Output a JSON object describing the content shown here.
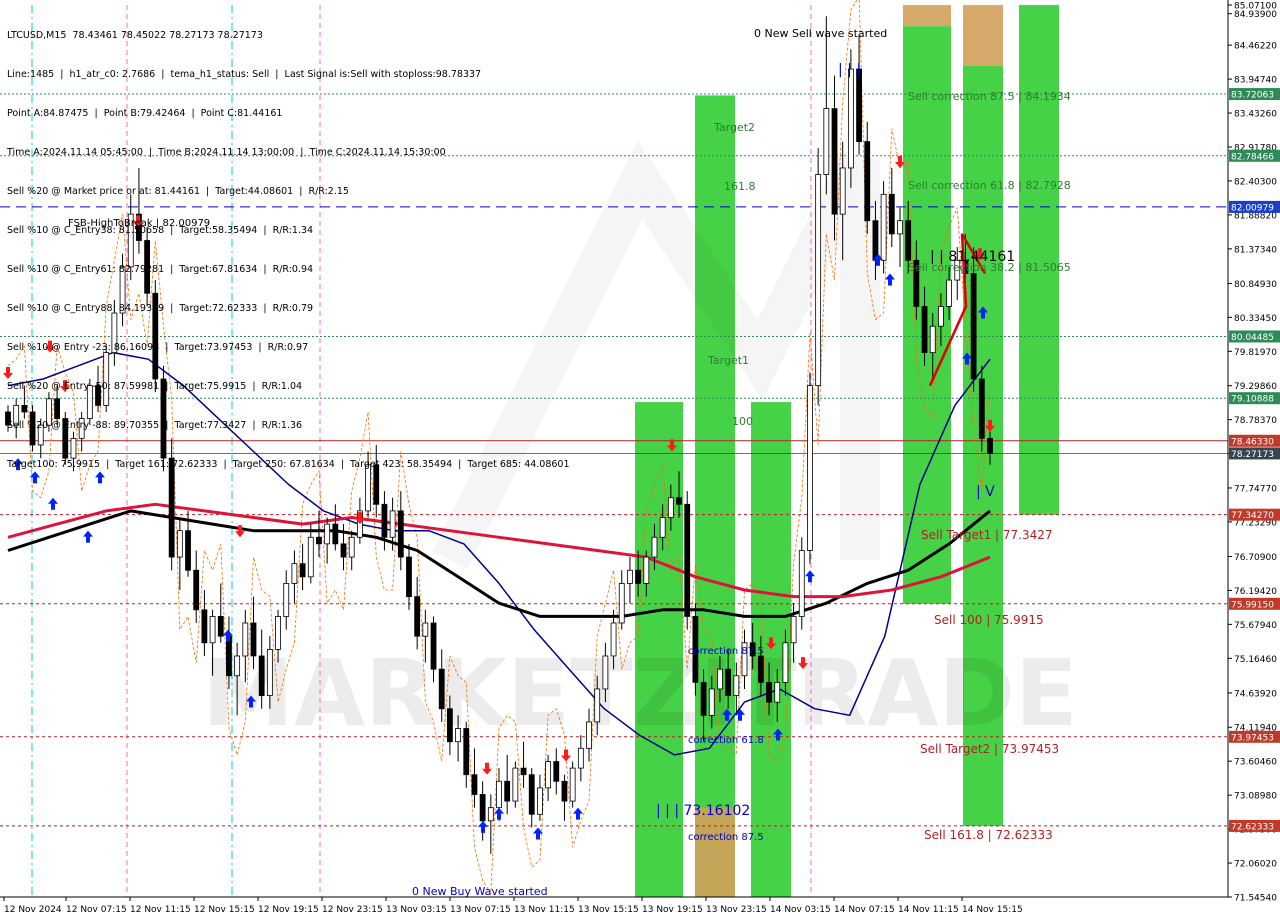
{
  "symbol_header": "LTCUSD,M15  78.43461 78.45022 78.27173 78.27173",
  "info_lines": [
    "Line:1485  |  h1_atr_c0: 2.7686  |  tema_h1_status: Sell  |  Last Signal is:Sell with stoploss:98.78337",
    "Point A:84.87475  |  Point B:79.42464  |  Point C:81.44161",
    "Time A:2024.11.14 05:45:00  |  Time B:2024.11.14 13:00:00  |  Time C:2024.11.14 15:30:00",
    "Sell %20 @ Market price or at: 81.44161  |  Target:44.08601  |  R/R:2.15",
    "Sell %10 @ C_Entry38: 81.50658  |  Target:58.35494  |  R/R:1.34",
    "Sell %10 @ C_Entry61: 82.79281  |  Target:67.81634  |  R/R:0.94",
    "Sell %10 @ C_Entry88: 84.19349  |  Target:72.62333  |  R/R:0.79",
    "Sell %10 @ Entry -23: 86.16098  |  Target:73.97453  |  R/R:0.97",
    "Sell %20 @ Entry -50: 87.59981  |  Target:75.9915  |  R/R:1.04",
    "Sell %20 @ Entry -88: 89.70355  |  Target:77.3427  |  R/R:1.36",
    "Target100: 75.9915  |  Target 161: 72.62333  |  Target 250: 67.81634  |  Target 423: 58.35494  |  Target 685: 44.08601"
  ],
  "watermark": "MARKETZITRADE",
  "colors": {
    "bull_candle": "#000000",
    "bear_candle": "#000000",
    "ema_blue": "#00008b",
    "ema_black": "#000000",
    "ema_red": "#dc143c",
    "green_zone": "#32cd32",
    "orange_zone": "#d2a05a",
    "level_green": "#2e8b57",
    "level_red": "#b22222",
    "level_blue": "#0000cd",
    "price_current": "#36454f"
  },
  "chart_data": {
    "type": "candlestick",
    "title": "LTCUSD,M15",
    "ylim": [
      71.5454,
      85.071
    ],
    "y_ticks": [
      "85.07100",
      "84.93900",
      "84.46220",
      "83.94740",
      "83.43260",
      "82.91780",
      "82.40300",
      "81.88820",
      "81.37340",
      "80.84930",
      "80.33450",
      "79.81970",
      "79.29860",
      "78.78370",
      "78.26890",
      "77.74770",
      "77.23290",
      "76.70900",
      "76.19420",
      "75.67940",
      "75.16460",
      "74.63920",
      "74.11940",
      "73.60460",
      "73.08980",
      "72.57500",
      "72.06020",
      "71.54540"
    ],
    "x_ticks": [
      "12 Nov 2024",
      "12 Nov 07:15",
      "12 Nov 11:15",
      "12 Nov 15:15",
      "12 Nov 19:15",
      "12 Nov 23:15",
      "13 Nov 03:15",
      "13 Nov 07:15",
      "13 Nov 11:15",
      "13 Nov 15:15",
      "13 Nov 19:15",
      "13 Nov 23:15",
      "14 Nov 03:15",
      "14 Nov 07:15",
      "14 Nov 11:15",
      "14 Nov 15:15"
    ],
    "price_tags": [
      {
        "value": "83.72063",
        "kind": "green"
      },
      {
        "value": "82.78466",
        "kind": "green"
      },
      {
        "value": "82.00979",
        "kind": "blue"
      },
      {
        "value": "80.04485",
        "kind": "green"
      },
      {
        "value": "79.10888",
        "kind": "green"
      },
      {
        "value": "78.46330",
        "kind": "red"
      },
      {
        "value": "78.27173",
        "kind": "current"
      },
      {
        "value": "77.34270",
        "kind": "red"
      },
      {
        "value": "75.99150",
        "kind": "red"
      },
      {
        "value": "73.97453",
        "kind": "red"
      },
      {
        "value": "72.62333",
        "kind": "red"
      }
    ],
    "levels": [
      {
        "price": 83.72063,
        "style": "green-dotted"
      },
      {
        "price": 82.78466,
        "style": "green-dotted"
      },
      {
        "price": 82.00979,
        "style": "blue-dashed"
      },
      {
        "price": 80.04485,
        "style": "green-dotted"
      },
      {
        "price": 79.10888,
        "style": "green-dotted"
      },
      {
        "price": 78.4633,
        "style": "red-solid"
      },
      {
        "price": 78.27173,
        "style": "current"
      },
      {
        "price": 77.3427,
        "style": "red-dashed"
      },
      {
        "price": 75.9915,
        "style": "red-dashed"
      },
      {
        "price": 73.97453,
        "style": "red-dashed"
      },
      {
        "price": 72.62333,
        "style": "red-dashed"
      }
    ],
    "annotations": {
      "fsb_label": "FSB-HighToBreak  |  82.00979",
      "new_sell_wave": "0 New Sell wave started",
      "new_buy_wave": "0 New Buy Wave started",
      "target2": "Target2",
      "target1": "Target1",
      "fib_1618": "161.8",
      "fib_100": "100",
      "correction_875_top": "correction 87.5",
      "correction_618": "correction 61.8",
      "correction_875_bottom": "correction 87.5",
      "point_low": "| | | 73.16102",
      "point_high": "| | |",
      "point_c": "| | 81.44161",
      "sell_corr_875": "Sell correction 87.5 | 84.1934",
      "sell_corr_618": "Sell correction 61.8 | 82.7928",
      "sell_corr_382": "Sell correction 38.2 | 81.5065",
      "sell_target1": "Sell Target1 | 77.3427",
      "sell_100": "Sell 100 | 75.9915",
      "sell_target2": "Sell Target2 | 73.97453",
      "sell_1618": "Sell 161.8 | 72.62333",
      "iv_mark": "| V"
    },
    "series": [
      {
        "name": "EMA blue",
        "values": [
          79.3,
          79.4,
          79.6,
          79.8,
          79.7,
          79.3,
          78.8,
          78.3,
          77.8,
          77.4,
          77.2,
          77.1,
          77.1,
          76.9,
          76.3,
          75.6,
          75.0,
          74.4,
          74.0,
          73.7,
          73.8,
          74.5,
          74.7,
          74.4,
          74.3,
          75.5,
          77.8,
          79.0,
          79.7
        ]
      },
      {
        "name": "EMA black",
        "values": [
          76.8,
          77.0,
          77.2,
          77.4,
          77.3,
          77.2,
          77.1,
          77.1,
          77.1,
          77.0,
          76.8,
          76.4,
          76.0,
          75.8,
          75.8,
          75.8,
          75.9,
          75.9,
          75.8,
          75.8,
          76.0,
          76.3,
          76.5,
          76.9,
          77.4
        ]
      },
      {
        "name": "EMA red",
        "values": [
          77.0,
          77.2,
          77.4,
          77.5,
          77.4,
          77.3,
          77.2,
          77.3,
          77.2,
          77.1,
          77.0,
          76.9,
          76.8,
          76.7,
          76.4,
          76.2,
          76.1,
          76.1,
          76.2,
          76.4,
          76.7
        ]
      }
    ],
    "candles": [
      [
        78.9,
        79.0,
        78.6,
        78.7
      ],
      [
        78.7,
        79.1,
        78.5,
        79.0
      ],
      [
        79.0,
        79.3,
        78.8,
        78.9
      ],
      [
        78.9,
        79.0,
        78.3,
        78.4
      ],
      [
        78.4,
        78.8,
        78.2,
        78.7
      ],
      [
        78.7,
        79.2,
        78.6,
        79.1
      ],
      [
        79.1,
        79.3,
        78.7,
        78.8
      ],
      [
        78.8,
        78.9,
        78.1,
        78.2
      ],
      [
        78.2,
        78.6,
        78.0,
        78.5
      ],
      [
        78.5,
        78.9,
        78.3,
        78.8
      ],
      [
        78.8,
        79.4,
        78.7,
        79.3
      ],
      [
        79.3,
        79.6,
        78.9,
        79.0
      ],
      [
        79.0,
        79.9,
        78.9,
        79.8
      ],
      [
        79.8,
        80.6,
        79.6,
        80.4
      ],
      [
        80.4,
        81.3,
        80.2,
        81.1
      ],
      [
        81.1,
        82.2,
        80.9,
        81.9
      ],
      [
        81.9,
        82.6,
        81.3,
        81.5
      ],
      [
        81.5,
        81.7,
        80.5,
        80.7
      ],
      [
        80.7,
        80.9,
        79.2,
        79.4
      ],
      [
        79.4,
        79.6,
        78.0,
        78.2
      ],
      [
        78.2,
        78.5,
        76.5,
        76.7
      ],
      [
        76.7,
        77.3,
        76.2,
        77.1
      ],
      [
        77.1,
        77.4,
        76.4,
        76.5
      ],
      [
        76.5,
        76.8,
        75.7,
        75.9
      ],
      [
        75.9,
        76.2,
        75.2,
        75.4
      ],
      [
        75.4,
        75.9,
        74.9,
        75.8
      ],
      [
        75.8,
        76.3,
        75.4,
        75.5
      ],
      [
        75.5,
        75.8,
        74.7,
        74.9
      ],
      [
        74.9,
        75.4,
        74.3,
        75.2
      ],
      [
        75.2,
        75.9,
        74.8,
        75.7
      ],
      [
        75.7,
        76.1,
        75.0,
        75.2
      ],
      [
        75.2,
        75.6,
        74.4,
        74.6
      ],
      [
        74.6,
        75.5,
        74.4,
        75.3
      ],
      [
        75.3,
        75.9,
        75.1,
        75.8
      ],
      [
        75.8,
        76.5,
        75.6,
        76.3
      ],
      [
        76.3,
        76.8,
        76.0,
        76.6
      ],
      [
        76.6,
        76.9,
        76.2,
        76.4
      ],
      [
        76.4,
        77.2,
        76.3,
        77.0
      ],
      [
        77.0,
        77.4,
        76.7,
        76.9
      ],
      [
        76.9,
        77.3,
        76.6,
        77.2
      ],
      [
        77.2,
        77.5,
        76.8,
        76.9
      ],
      [
        76.9,
        77.2,
        76.5,
        76.7
      ],
      [
        76.7,
        77.1,
        76.5,
        77.0
      ],
      [
        77.0,
        77.6,
        76.9,
        77.4
      ],
      [
        77.4,
        78.3,
        77.3,
        78.1
      ],
      [
        78.1,
        78.4,
        77.3,
        77.5
      ],
      [
        77.5,
        77.7,
        76.8,
        77.0
      ],
      [
        77.0,
        77.6,
        76.8,
        77.4
      ],
      [
        77.4,
        77.7,
        76.5,
        76.7
      ],
      [
        76.7,
        76.9,
        75.9,
        76.1
      ],
      [
        76.1,
        76.4,
        75.3,
        75.5
      ],
      [
        75.5,
        75.9,
        75.1,
        75.7
      ],
      [
        75.7,
        75.8,
        74.8,
        75.0
      ],
      [
        75.0,
        75.3,
        74.2,
        74.4
      ],
      [
        74.4,
        74.6,
        73.7,
        73.9
      ],
      [
        73.9,
        74.3,
        73.6,
        74.1
      ],
      [
        74.1,
        74.2,
        73.2,
        73.4
      ],
      [
        73.4,
        73.8,
        72.9,
        73.1
      ],
      [
        73.1,
        73.3,
        72.4,
        72.7
      ],
      [
        72.7,
        73.1,
        72.2,
        72.9
      ],
      [
        72.9,
        73.5,
        72.7,
        73.3
      ],
      [
        73.3,
        73.7,
        72.8,
        73.0
      ],
      [
        73.0,
        73.6,
        72.9,
        73.5
      ],
      [
        73.5,
        73.9,
        73.2,
        73.4
      ],
      [
        73.4,
        73.5,
        72.6,
        72.8
      ],
      [
        72.8,
        73.4,
        72.7,
        73.2
      ],
      [
        73.2,
        73.7,
        73.0,
        73.6
      ],
      [
        73.6,
        73.8,
        73.1,
        73.3
      ],
      [
        73.3,
        73.4,
        72.7,
        73.0
      ],
      [
        73.0,
        73.6,
        72.9,
        73.5
      ],
      [
        73.5,
        74.0,
        73.3,
        73.8
      ],
      [
        73.8,
        74.4,
        73.6,
        74.2
      ],
      [
        74.2,
        74.9,
        74.0,
        74.7
      ],
      [
        74.7,
        75.4,
        74.5,
        75.2
      ],
      [
        75.2,
        75.9,
        75.0,
        75.7
      ],
      [
        75.7,
        76.5,
        75.6,
        76.3
      ],
      [
        76.3,
        76.7,
        76.0,
        76.5
      ],
      [
        76.5,
        76.8,
        76.1,
        76.3
      ],
      [
        76.3,
        76.8,
        76.1,
        76.7
      ],
      [
        76.7,
        77.2,
        76.5,
        77.0
      ],
      [
        77.0,
        77.5,
        76.8,
        77.3
      ],
      [
        77.3,
        77.8,
        77.1,
        77.6
      ],
      [
        77.6,
        78.0,
        77.3,
        77.5
      ],
      [
        77.5,
        77.7,
        75.6,
        75.8
      ],
      [
        75.8,
        76.0,
        74.6,
        74.8
      ],
      [
        74.8,
        75.0,
        73.9,
        74.3
      ],
      [
        74.3,
        74.9,
        74.1,
        74.7
      ],
      [
        74.7,
        75.2,
        74.5,
        75.0
      ],
      [
        75.0,
        75.3,
        74.4,
        74.6
      ],
      [
        74.6,
        75.1,
        74.3,
        74.9
      ],
      [
        74.9,
        75.6,
        74.7,
        75.4
      ],
      [
        75.4,
        75.7,
        75.0,
        75.2
      ],
      [
        75.2,
        75.5,
        74.6,
        74.8
      ],
      [
        74.8,
        75.1,
        74.3,
        74.5
      ],
      [
        74.5,
        75.0,
        74.2,
        74.8
      ],
      [
        74.8,
        75.6,
        74.6,
        75.4
      ],
      [
        75.4,
        76.0,
        75.1,
        75.8
      ],
      [
        75.8,
        77.0,
        75.6,
        76.8
      ],
      [
        76.8,
        79.5,
        76.6,
        79.3
      ],
      [
        79.3,
        82.9,
        79.0,
        82.5
      ],
      [
        82.5,
        84.9,
        82.2,
        83.5
      ],
      [
        83.5,
        84.0,
        81.5,
        81.9
      ],
      [
        81.9,
        83.0,
        81.2,
        82.6
      ],
      [
        82.6,
        84.4,
        82.3,
        84.1
      ],
      [
        84.1,
        84.6,
        82.8,
        83.0
      ],
      [
        83.0,
        83.3,
        81.6,
        81.8
      ],
      [
        81.8,
        82.1,
        80.9,
        81.2
      ],
      [
        81.2,
        82.4,
        81.0,
        82.2
      ],
      [
        82.2,
        82.6,
        81.4,
        81.6
      ],
      [
        81.6,
        82.0,
        81.1,
        81.8
      ],
      [
        81.8,
        82.1,
        81.0,
        81.2
      ],
      [
        81.2,
        81.5,
        80.3,
        80.5
      ],
      [
        80.5,
        80.8,
        79.6,
        79.8
      ],
      [
        79.8,
        80.4,
        79.4,
        80.2
      ],
      [
        80.2,
        80.7,
        79.9,
        80.5
      ],
      [
        80.5,
        81.1,
        80.3,
        80.9
      ],
      [
        80.9,
        81.4,
        80.6,
        81.2
      ],
      [
        81.2,
        81.6,
        80.8,
        81.0
      ],
      [
        81.0,
        81.4,
        79.2,
        79.4
      ],
      [
        79.4,
        79.6,
        78.3,
        78.5
      ],
      [
        78.5,
        78.7,
        78.1,
        78.27
      ]
    ]
  }
}
